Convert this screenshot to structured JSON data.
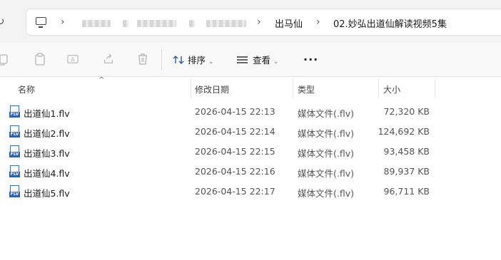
{
  "breadcrumb": {
    "blurred_items": [
      "",
      "",
      ""
    ],
    "items": [
      {
        "label": "出马仙"
      },
      {
        "label": "02.妙弘出道仙解读视频5集"
      }
    ]
  },
  "toolbar": {
    "sort_label": "排序",
    "view_label": "查看",
    "more_label": "···"
  },
  "columns": {
    "name": "名称",
    "date": "修改日期",
    "type": "类型",
    "size": "大小"
  },
  "files": [
    {
      "name": "出道仙1.flv",
      "date": "2026-04-15 22:13",
      "type": "媒体文件(.flv)",
      "size": "72,320 KB",
      "icon": "flv-file-icon"
    },
    {
      "name": "出道仙2.flv",
      "date": "2026-04-15 22:14",
      "type": "媒体文件(.flv)",
      "size": "124,692 KB",
      "icon": "flv-file-icon"
    },
    {
      "name": "出道仙3.flv",
      "date": "2026-04-15 22:15",
      "type": "媒体文件(.flv)",
      "size": "93,458 KB",
      "icon": "flv-file-icon"
    },
    {
      "name": "出道仙4.flv",
      "date": "2026-04-15 22:16",
      "type": "媒体文件(.flv)",
      "size": "89,937 KB",
      "icon": "flv-file-icon"
    },
    {
      "name": "出道仙5.flv",
      "date": "2026-04-15 22:17",
      "type": "媒体文件(.flv)",
      "size": "96,711 KB",
      "icon": "flv-file-icon"
    }
  ],
  "file_icon_tag": "FLV"
}
